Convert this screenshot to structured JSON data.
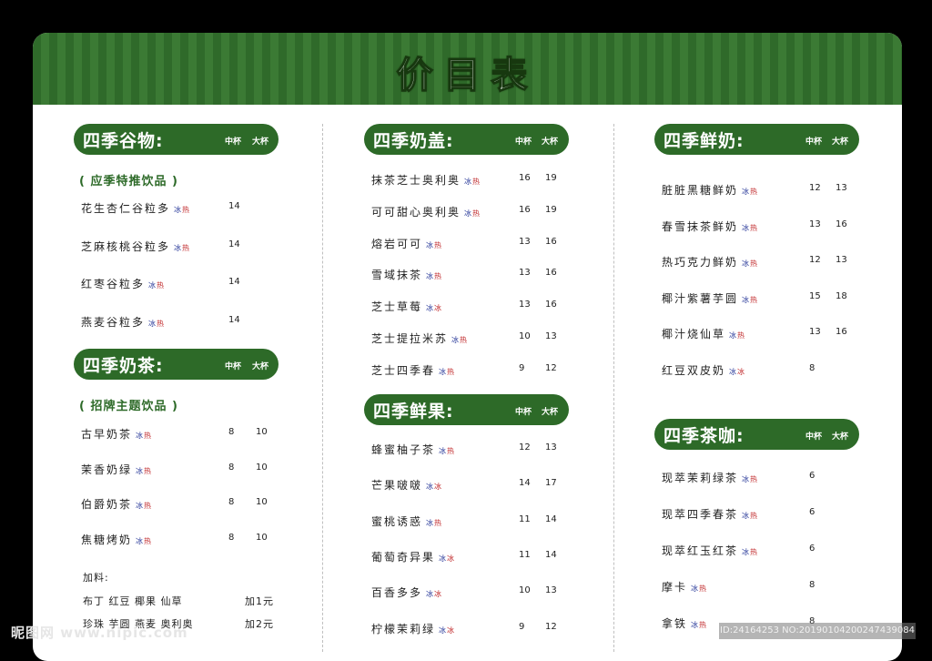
{
  "title": "价目表",
  "size_labels": {
    "medium": "中杯",
    "large": "大杯"
  },
  "temp": {
    "cold": "冰",
    "hot": "热"
  },
  "columns": [
    {
      "sections": [
        {
          "name": "四季谷物:",
          "subtitle": "( 应季特推饮品 )",
          "items": [
            {
              "name": "花生杏仁谷粒多",
              "temps": [
                "冰",
                "热"
              ],
              "p1": "14",
              "p2": ""
            },
            {
              "name": "芝麻核桃谷粒多",
              "temps": [
                "冰",
                "热"
              ],
              "p1": "14",
              "p2": ""
            },
            {
              "name": "红枣谷粒多",
              "temps": [
                "冰",
                "热"
              ],
              "p1": "14",
              "p2": ""
            },
            {
              "name": "燕麦谷粒多",
              "temps": [
                "冰",
                "热"
              ],
              "p1": "14",
              "p2": ""
            }
          ]
        },
        {
          "name": "四季奶茶:",
          "subtitle": "( 招牌主题饮品 )",
          "items": [
            {
              "name": "古早奶茶",
              "temps": [
                "冰",
                "热"
              ],
              "p1": "8",
              "p2": "10"
            },
            {
              "name": "茉香奶绿",
              "temps": [
                "冰",
                "热"
              ],
              "p1": "8",
              "p2": "10"
            },
            {
              "name": "伯爵奶茶",
              "temps": [
                "冰",
                "热"
              ],
              "p1": "8",
              "p2": "10"
            },
            {
              "name": "焦糖烤奶",
              "temps": [
                "冰",
                "热"
              ],
              "p1": "8",
              "p2": "10"
            }
          ]
        }
      ],
      "addons": {
        "label": "加料:",
        "rows": [
          {
            "items": "布丁 红豆 椰果 仙草",
            "price": "加1元"
          },
          {
            "items": "珍珠 芋圆 燕麦 奥利奥",
            "price": "加2元"
          }
        ]
      }
    },
    {
      "sections": [
        {
          "name": "四季奶盖:",
          "subtitle": "",
          "items": [
            {
              "name": "抹茶芝士奥利奥",
              "temps": [
                "冰",
                "热"
              ],
              "p1": "16",
              "p2": "19"
            },
            {
              "name": "可可甜心奥利奥",
              "temps": [
                "冰",
                "热"
              ],
              "p1": "16",
              "p2": "19"
            },
            {
              "name": "熔岩可可",
              "temps": [
                "冰",
                "热"
              ],
              "p1": "13",
              "p2": "16"
            },
            {
              "name": "雪域抹茶",
              "temps": [
                "冰",
                "热"
              ],
              "p1": "13",
              "p2": "16"
            },
            {
              "name": "芝士草莓",
              "temps": [
                "冰",
                "冰"
              ],
              "p1": "13",
              "p2": "16"
            },
            {
              "name": "芝士提拉米苏",
              "temps": [
                "冰",
                "热"
              ],
              "p1": "10",
              "p2": "13"
            },
            {
              "name": "芝士四季春",
              "temps": [
                "冰",
                "热"
              ],
              "p1": "9",
              "p2": "12"
            }
          ]
        },
        {
          "name": "四季鲜果:",
          "subtitle": "",
          "items": [
            {
              "name": "蜂蜜柚子茶",
              "temps": [
                "冰",
                "热"
              ],
              "p1": "12",
              "p2": "13"
            },
            {
              "name": "芒果啵啵",
              "temps": [
                "冰",
                "冰"
              ],
              "p1": "14",
              "p2": "17"
            },
            {
              "name": "蜜桃诱惑",
              "temps": [
                "冰",
                "热"
              ],
              "p1": "11",
              "p2": "14"
            },
            {
              "name": "葡萄奇异果",
              "temps": [
                "冰",
                "冰"
              ],
              "p1": "11",
              "p2": "14"
            },
            {
              "name": "百香多多",
              "temps": [
                "冰",
                "冰"
              ],
              "p1": "10",
              "p2": "13"
            },
            {
              "name": "柠檬茉莉绿",
              "temps": [
                "冰",
                "冰"
              ],
              "p1": "9",
              "p2": "12"
            }
          ]
        }
      ]
    },
    {
      "sections": [
        {
          "name": "四季鲜奶:",
          "subtitle": "",
          "items": [
            {
              "name": "脏脏黑糖鲜奶",
              "temps": [
                "冰",
                "热"
              ],
              "p1": "12",
              "p2": "13"
            },
            {
              "name": "春雪抹茶鲜奶",
              "temps": [
                "冰",
                "热"
              ],
              "p1": "13",
              "p2": "16"
            },
            {
              "name": "热巧克力鲜奶",
              "temps": [
                "冰",
                "热"
              ],
              "p1": "12",
              "p2": "13"
            },
            {
              "name": "椰汁紫薯芋圆",
              "temps": [
                "冰",
                "热"
              ],
              "p1": "15",
              "p2": "18"
            },
            {
              "name": "椰汁烧仙草",
              "temps": [
                "冰",
                "热"
              ],
              "p1": "13",
              "p2": "16"
            },
            {
              "name": "红豆双皮奶",
              "temps": [
                "冰",
                "冰"
              ],
              "p1": "8",
              "p2": ""
            }
          ]
        },
        {
          "name": "四季茶咖:",
          "subtitle": "",
          "items": [
            {
              "name": "现萃茉莉绿茶",
              "temps": [
                "冰",
                "热"
              ],
              "p1": "6",
              "p2": ""
            },
            {
              "name": "现萃四季春茶",
              "temps": [
                "冰",
                "热"
              ],
              "p1": "6",
              "p2": ""
            },
            {
              "name": "现萃红玉红茶",
              "temps": [
                "冰",
                "热"
              ],
              "p1": "6",
              "p2": ""
            },
            {
              "name": "摩卡",
              "temps": [
                "冰",
                "热"
              ],
              "p1": "8",
              "p2": ""
            },
            {
              "name": "拿铁",
              "temps": [
                "冰",
                "热"
              ],
              "p1": "8",
              "p2": ""
            }
          ]
        }
      ]
    }
  ],
  "watermark": {
    "left": "昵图网 www.nipic.com",
    "right": "ID:24164253 NO:20190104200247439084"
  },
  "colors": {
    "green": "#2d6a28",
    "cold": "#2a3a9a",
    "hot": "#c0282a"
  }
}
